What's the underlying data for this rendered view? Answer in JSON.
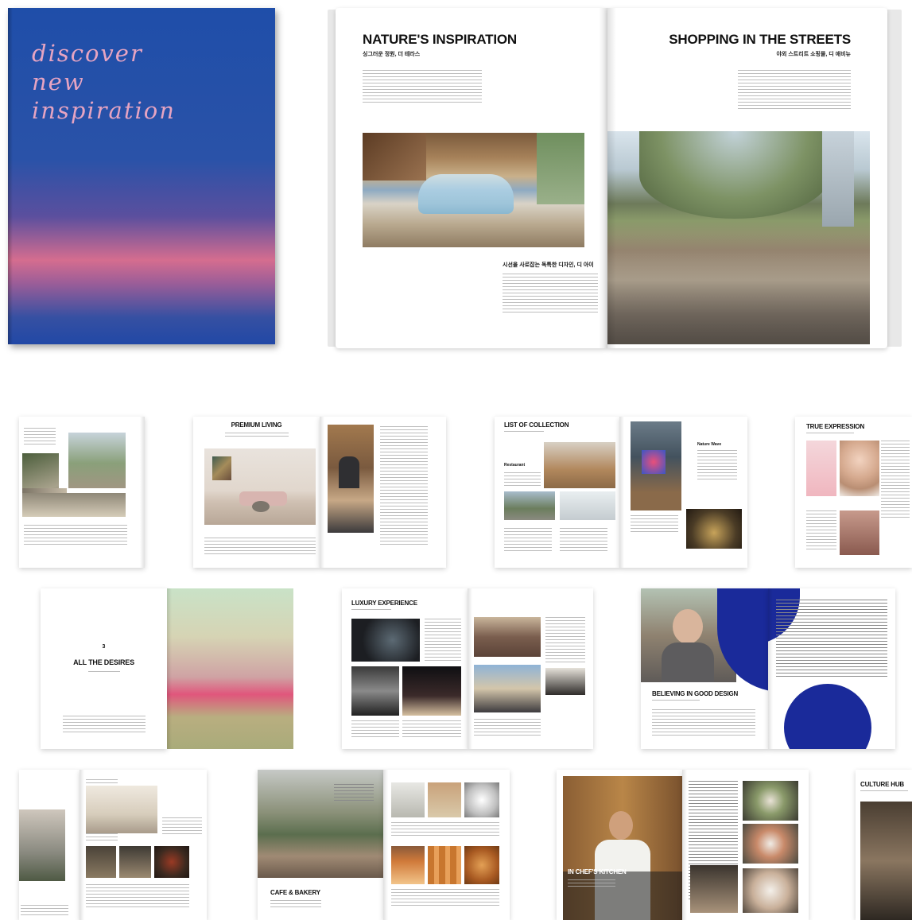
{
  "cover": {
    "line1": "discover",
    "line2": "new",
    "line3": "inspiration"
  },
  "spread_main": {
    "left_title": "NATURE'S INSPIRATION",
    "left_subtitle": "싱그러운 정원, 더 테라스",
    "left_caption_title": "시선을 사로잡는 독특한 디자인, 디 아이",
    "right_title": "SHOPPING IN THE STREETS",
    "right_subtitle": "야외 스트리트 쇼핑몰, 디 애비뉴"
  },
  "row2": {
    "premium_title": "PREMIUM LIVING",
    "collection_title": "LIST OF COLLECTION",
    "collection_item1": "Restaurant",
    "collection_item2": "Nature Wave",
    "true_title": "TRUE EXPRESSION"
  },
  "row3": {
    "desires_number": "3",
    "desires_title": "ALL THE DESIRES",
    "luxury_title": "LUXURY EXPERIENCE",
    "design_title": "BELIEVING IN GOOD DESIGN"
  },
  "row4": {
    "cafe_title": "CAFE & BAKERY",
    "chef_title": "IN CHEF'S KITCHEN",
    "culture_title": "CULTURE HUB"
  },
  "colors": {
    "cover_blue": "#1d4fae",
    "cover_pink": "#e0708c",
    "accent_navy": "#1a2a9a"
  }
}
